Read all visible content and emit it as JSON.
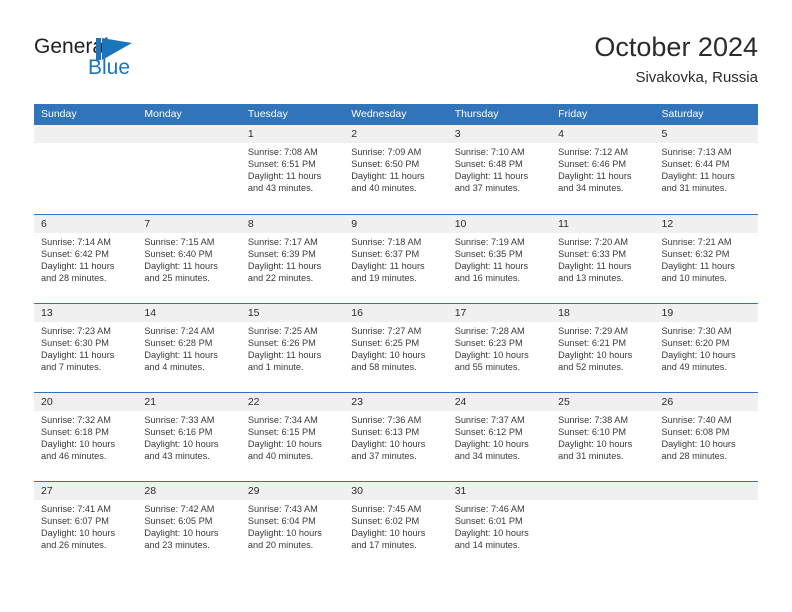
{
  "brand": {
    "name_part1": "General",
    "name_part2": "Blue",
    "accent_color": "#1b75bb"
  },
  "header": {
    "title": "October 2024",
    "location": "Sivakovka, Russia"
  },
  "calendar": {
    "header_bg": "#3174b9",
    "weekdays": [
      "Sunday",
      "Monday",
      "Tuesday",
      "Wednesday",
      "Thursday",
      "Friday",
      "Saturday"
    ],
    "weeks": [
      [
        {
          "day": "",
          "lines": []
        },
        {
          "day": "",
          "lines": []
        },
        {
          "day": "1",
          "lines": [
            "Sunrise: 7:08 AM",
            "Sunset: 6:51 PM",
            "Daylight: 11 hours",
            "and 43 minutes."
          ]
        },
        {
          "day": "2",
          "lines": [
            "Sunrise: 7:09 AM",
            "Sunset: 6:50 PM",
            "Daylight: 11 hours",
            "and 40 minutes."
          ]
        },
        {
          "day": "3",
          "lines": [
            "Sunrise: 7:10 AM",
            "Sunset: 6:48 PM",
            "Daylight: 11 hours",
            "and 37 minutes."
          ]
        },
        {
          "day": "4",
          "lines": [
            "Sunrise: 7:12 AM",
            "Sunset: 6:46 PM",
            "Daylight: 11 hours",
            "and 34 minutes."
          ]
        },
        {
          "day": "5",
          "lines": [
            "Sunrise: 7:13 AM",
            "Sunset: 6:44 PM",
            "Daylight: 11 hours",
            "and 31 minutes."
          ]
        }
      ],
      [
        {
          "day": "6",
          "lines": [
            "Sunrise: 7:14 AM",
            "Sunset: 6:42 PM",
            "Daylight: 11 hours",
            "and 28 minutes."
          ]
        },
        {
          "day": "7",
          "lines": [
            "Sunrise: 7:15 AM",
            "Sunset: 6:40 PM",
            "Daylight: 11 hours",
            "and 25 minutes."
          ]
        },
        {
          "day": "8",
          "lines": [
            "Sunrise: 7:17 AM",
            "Sunset: 6:39 PM",
            "Daylight: 11 hours",
            "and 22 minutes."
          ]
        },
        {
          "day": "9",
          "lines": [
            "Sunrise: 7:18 AM",
            "Sunset: 6:37 PM",
            "Daylight: 11 hours",
            "and 19 minutes."
          ]
        },
        {
          "day": "10",
          "lines": [
            "Sunrise: 7:19 AM",
            "Sunset: 6:35 PM",
            "Daylight: 11 hours",
            "and 16 minutes."
          ]
        },
        {
          "day": "11",
          "lines": [
            "Sunrise: 7:20 AM",
            "Sunset: 6:33 PM",
            "Daylight: 11 hours",
            "and 13 minutes."
          ]
        },
        {
          "day": "12",
          "lines": [
            "Sunrise: 7:21 AM",
            "Sunset: 6:32 PM",
            "Daylight: 11 hours",
            "and 10 minutes."
          ]
        }
      ],
      [
        {
          "day": "13",
          "lines": [
            "Sunrise: 7:23 AM",
            "Sunset: 6:30 PM",
            "Daylight: 11 hours",
            "and 7 minutes."
          ]
        },
        {
          "day": "14",
          "lines": [
            "Sunrise: 7:24 AM",
            "Sunset: 6:28 PM",
            "Daylight: 11 hours",
            "and 4 minutes."
          ]
        },
        {
          "day": "15",
          "lines": [
            "Sunrise: 7:25 AM",
            "Sunset: 6:26 PM",
            "Daylight: 11 hours",
            "and 1 minute."
          ]
        },
        {
          "day": "16",
          "lines": [
            "Sunrise: 7:27 AM",
            "Sunset: 6:25 PM",
            "Daylight: 10 hours",
            "and 58 minutes."
          ]
        },
        {
          "day": "17",
          "lines": [
            "Sunrise: 7:28 AM",
            "Sunset: 6:23 PM",
            "Daylight: 10 hours",
            "and 55 minutes."
          ]
        },
        {
          "day": "18",
          "lines": [
            "Sunrise: 7:29 AM",
            "Sunset: 6:21 PM",
            "Daylight: 10 hours",
            "and 52 minutes."
          ]
        },
        {
          "day": "19",
          "lines": [
            "Sunrise: 7:30 AM",
            "Sunset: 6:20 PM",
            "Daylight: 10 hours",
            "and 49 minutes."
          ]
        }
      ],
      [
        {
          "day": "20",
          "lines": [
            "Sunrise: 7:32 AM",
            "Sunset: 6:18 PM",
            "Daylight: 10 hours",
            "and 46 minutes."
          ]
        },
        {
          "day": "21",
          "lines": [
            "Sunrise: 7:33 AM",
            "Sunset: 6:16 PM",
            "Daylight: 10 hours",
            "and 43 minutes."
          ]
        },
        {
          "day": "22",
          "lines": [
            "Sunrise: 7:34 AM",
            "Sunset: 6:15 PM",
            "Daylight: 10 hours",
            "and 40 minutes."
          ]
        },
        {
          "day": "23",
          "lines": [
            "Sunrise: 7:36 AM",
            "Sunset: 6:13 PM",
            "Daylight: 10 hours",
            "and 37 minutes."
          ]
        },
        {
          "day": "24",
          "lines": [
            "Sunrise: 7:37 AM",
            "Sunset: 6:12 PM",
            "Daylight: 10 hours",
            "and 34 minutes."
          ]
        },
        {
          "day": "25",
          "lines": [
            "Sunrise: 7:38 AM",
            "Sunset: 6:10 PM",
            "Daylight: 10 hours",
            "and 31 minutes."
          ]
        },
        {
          "day": "26",
          "lines": [
            "Sunrise: 7:40 AM",
            "Sunset: 6:08 PM",
            "Daylight: 10 hours",
            "and 28 minutes."
          ]
        }
      ],
      [
        {
          "day": "27",
          "lines": [
            "Sunrise: 7:41 AM",
            "Sunset: 6:07 PM",
            "Daylight: 10 hours",
            "and 26 minutes."
          ]
        },
        {
          "day": "28",
          "lines": [
            "Sunrise: 7:42 AM",
            "Sunset: 6:05 PM",
            "Daylight: 10 hours",
            "and 23 minutes."
          ]
        },
        {
          "day": "29",
          "lines": [
            "Sunrise: 7:43 AM",
            "Sunset: 6:04 PM",
            "Daylight: 10 hours",
            "and 20 minutes."
          ]
        },
        {
          "day": "30",
          "lines": [
            "Sunrise: 7:45 AM",
            "Sunset: 6:02 PM",
            "Daylight: 10 hours",
            "and 17 minutes."
          ]
        },
        {
          "day": "31",
          "lines": [
            "Sunrise: 7:46 AM",
            "Sunset: 6:01 PM",
            "Daylight: 10 hours",
            "and 14 minutes."
          ]
        },
        {
          "day": "",
          "lines": []
        },
        {
          "day": "",
          "lines": []
        }
      ]
    ]
  }
}
